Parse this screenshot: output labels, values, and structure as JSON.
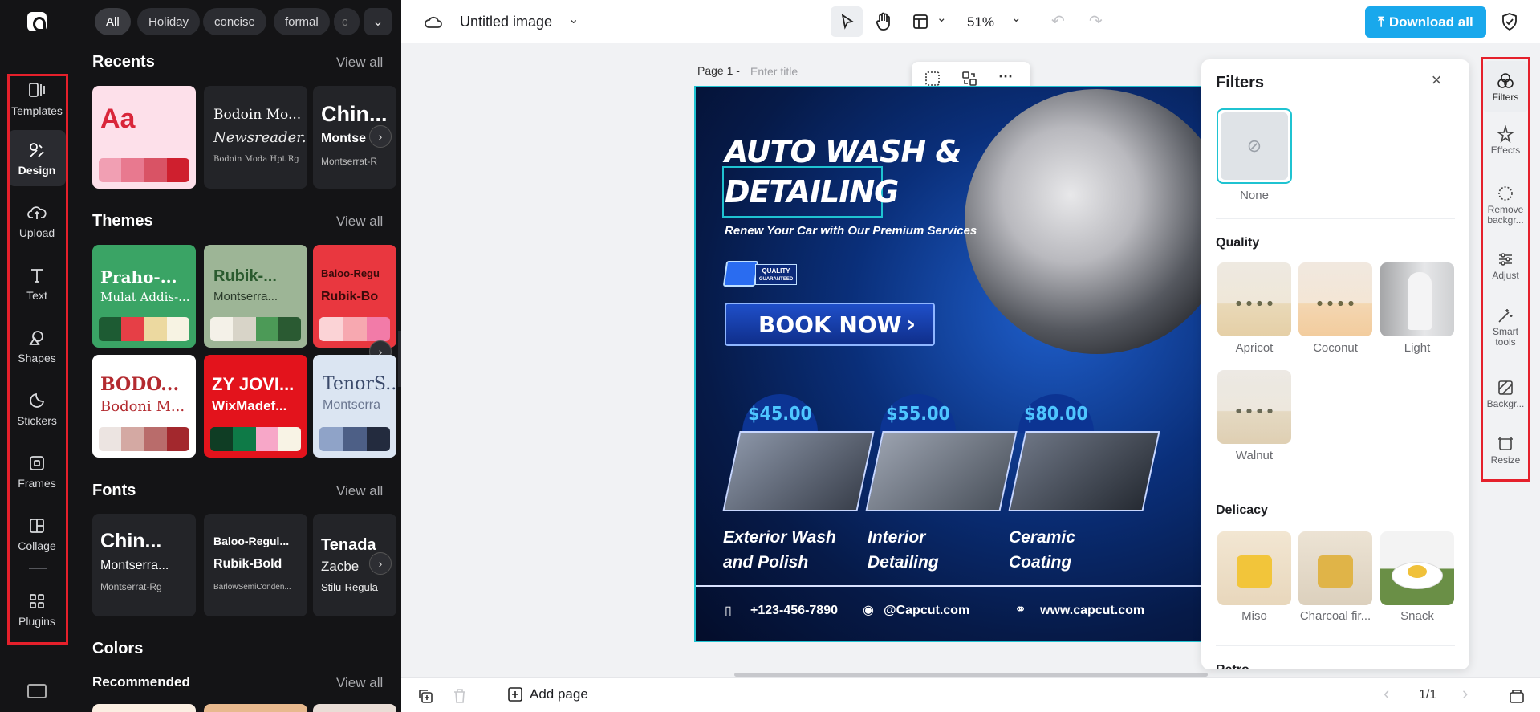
{
  "nav": {
    "items": [
      {
        "label": "Templates",
        "icon": "templates-icon"
      },
      {
        "label": "Design",
        "icon": "design-icon"
      },
      {
        "label": "Upload",
        "icon": "upload-icon"
      },
      {
        "label": "Text",
        "icon": "text-icon"
      },
      {
        "label": "Shapes",
        "icon": "shapes-icon"
      },
      {
        "label": "Stickers",
        "icon": "stickers-icon"
      },
      {
        "label": "Frames",
        "icon": "frames-icon"
      },
      {
        "label": "Collage",
        "icon": "collage-icon"
      },
      {
        "label": "Plugins",
        "icon": "plugins-icon"
      }
    ],
    "active": "Design"
  },
  "panel": {
    "chips": [
      "All",
      "Holiday",
      "concise",
      "formal",
      "c"
    ],
    "recents": {
      "title": "Recents",
      "view_all": "View all",
      "cards": [
        {
          "line1": "Aa"
        },
        {
          "line1": "Bodoin Mo...",
          "line2": "Newsreader...",
          "line3": "Bodoin Moda Hpt Rg"
        },
        {
          "line1": "Chin...",
          "line2": "Montse",
          "line3": "Montserrat-R"
        }
      ]
    },
    "themes": {
      "title": "Themes",
      "view_all": "View all",
      "cards": [
        {
          "line1": "Praho-...",
          "line2": "Mulat Addis-..."
        },
        {
          "line1": "Rubik-...",
          "line2": "Montserra..."
        },
        {
          "line1": "Baloo-Regu",
          "line2": "Rubik-Bo"
        },
        {
          "line1": "BODO...",
          "line2": "Bodoni M..."
        },
        {
          "line1": "ZY JOVI...",
          "line2": "WixMadef..."
        },
        {
          "line1": "TenorS...",
          "line2": "Montserra"
        }
      ]
    },
    "fonts": {
      "title": "Fonts",
      "view_all": "View all",
      "cards": [
        {
          "line1": "Chin...",
          "line2": "Montserra...",
          "line3": "Montserrat-Rg"
        },
        {
          "line1": "Baloo-Regul...",
          "line2": "Rubik-Bold",
          "line3": "BarlowSemiConden..."
        },
        {
          "line1": "Tenada",
          "line2": "Zacbe",
          "line3": "Stilu-Regula"
        }
      ]
    },
    "colors": {
      "title": "Colors",
      "recommended": "Recommended",
      "view_all": "View all"
    }
  },
  "topbar": {
    "doc_title": "Untitled image",
    "zoom": "51%",
    "download_label": "Download all"
  },
  "canvas": {
    "page_label": "Page 1 -",
    "page_title_placeholder": "Enter title",
    "poster": {
      "headline1": "AUTO WASH &",
      "headline2": "DETAILING",
      "subtitle": "Renew Your Car with Our Premium Services",
      "badge_line1": "QUALITY",
      "badge_line2": "GUARANTEED",
      "cta": "BOOK NOW",
      "prices": [
        "$45.00",
        "$55.00",
        "$80.00"
      ],
      "services": [
        {
          "l1": "Exterior Wash",
          "l2": "and Polish"
        },
        {
          "l1": "Interior",
          "l2": "Detailing"
        },
        {
          "l1": "Ceramic",
          "l2": "Coating"
        }
      ],
      "phone": "+123-456-7890",
      "social": "@Capcut.com",
      "website": "www.capcut.com"
    }
  },
  "filters": {
    "title": "Filters",
    "none_label": "None",
    "quality_title": "Quality",
    "quality": [
      "Apricot",
      "Coconut",
      "Light",
      "Walnut"
    ],
    "delicacy_title": "Delicacy",
    "delicacy": [
      "Miso",
      "Charcoal fir...",
      "Snack"
    ],
    "retro_title": "Retro"
  },
  "right_tools": [
    {
      "label": "Filters",
      "icon": "filters-icon"
    },
    {
      "label": "Effects",
      "icon": "effects-icon"
    },
    {
      "label": "Remove backgr...",
      "icon": "remove-background-icon"
    },
    {
      "label": "Adjust",
      "icon": "adjust-icon"
    },
    {
      "label": "Smart tools",
      "icon": "smart-tools-icon"
    },
    {
      "label": "Backgr...",
      "icon": "background-icon"
    },
    {
      "label": "Resize",
      "icon": "resize-icon"
    }
  ],
  "bottom": {
    "add_page": "Add page",
    "page_counter": "1/1"
  },
  "colors": {
    "accent": "#19a8ec",
    "highlight_box": "#e5202b",
    "selection": "#1fc3d1"
  }
}
